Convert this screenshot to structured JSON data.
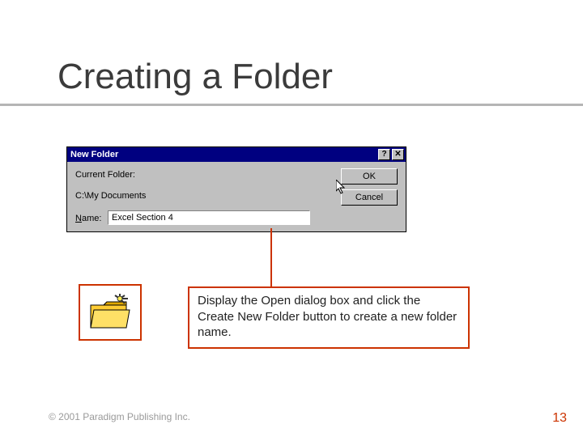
{
  "slide": {
    "title": "Creating a Folder",
    "copyright": "© 2001 Paradigm Publishing Inc.",
    "page_number": "13"
  },
  "dialog": {
    "window_title": "New Folder",
    "current_folder_label": "Current Folder:",
    "current_folder_path": "C:\\My Documents",
    "name_label_underlined": "N",
    "name_label_rest": "ame:",
    "name_value": "Excel Section 4",
    "ok_label": "OK",
    "cancel_label": "Cancel",
    "help_btn_glyph": "?",
    "close_btn_glyph": "✕"
  },
  "instruction": {
    "text": "Display the Open dialog box and click the Create New Folder button to create a new folder name."
  },
  "icons": {
    "folder": "folder-new-icon",
    "cursor": "cursor-arrow-icon"
  }
}
